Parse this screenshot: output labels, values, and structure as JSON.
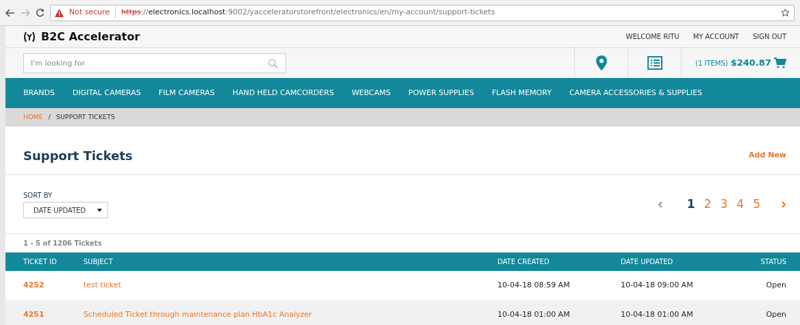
{
  "browser": {
    "security": "Not secure",
    "url": [
      {
        "text": "https",
        "kind": "struck"
      },
      {
        "text": "://",
        "kind": "plain"
      },
      {
        "text": "electronics.localhost",
        "kind": "host"
      },
      {
        "text": ":9002/yacceleratorstorefront/electronics/en/my-account/support-tickets",
        "kind": "plain"
      }
    ]
  },
  "header": {
    "brand": "B2C Accelerator",
    "links": [
      "WELCOME RITU",
      "MY ACCOUNT",
      "SIGN OUT"
    ]
  },
  "search": {
    "placeholder": "I'm looking for"
  },
  "cart": {
    "count": "(1 ITEMS)",
    "total": "$240.87"
  },
  "nav": [
    "BRANDS",
    "DIGITAL CAMERAS",
    "FILM CAMERAS",
    "HAND HELD CAMCORDERS",
    "WEBCAMS",
    "POWER SUPPLIES",
    "FLASH MEMORY",
    "CAMERA ACCESSORIES & SUPPLIES"
  ],
  "breadcrumb": [
    {
      "label": "HOME",
      "kind": "link"
    },
    {
      "label": "/",
      "kind": "separator"
    },
    {
      "label": "SUPPORT TICKETS",
      "kind": "current"
    }
  ],
  "page_title": "Support Tickets",
  "add_new": "Add New",
  "sort": {
    "label": "SORT BY",
    "value": "DATE UPDATED"
  },
  "pagination": {
    "prev_disabled": true,
    "next_disabled": false,
    "pages": [
      {
        "label": "1",
        "selected": true
      },
      {
        "label": "2",
        "selected": false
      },
      {
        "label": "3",
        "selected": false
      },
      {
        "label": "4",
        "selected": false
      },
      {
        "label": "5",
        "selected": false
      }
    ]
  },
  "count": "1 - 5 of 1206 Tickets",
  "table": {
    "columns": [
      "TICKET ID",
      "SUBJECT",
      "DATE CREATED",
      "DATE UPDATED",
      "STATUS"
    ],
    "rows": [
      {
        "id": "4252",
        "subject": "test ticket",
        "created": "10-04-18 08:59 AM",
        "updated": "10-04-18 09:00 AM",
        "status": "Open"
      },
      {
        "id": "4251",
        "subject": "Scheduled Ticket through maintenance plan HbA1c Analyzer",
        "created": "10-04-18 01:00 AM",
        "updated": "10-04-18 01:00 AM",
        "status": "Open"
      }
    ]
  }
}
